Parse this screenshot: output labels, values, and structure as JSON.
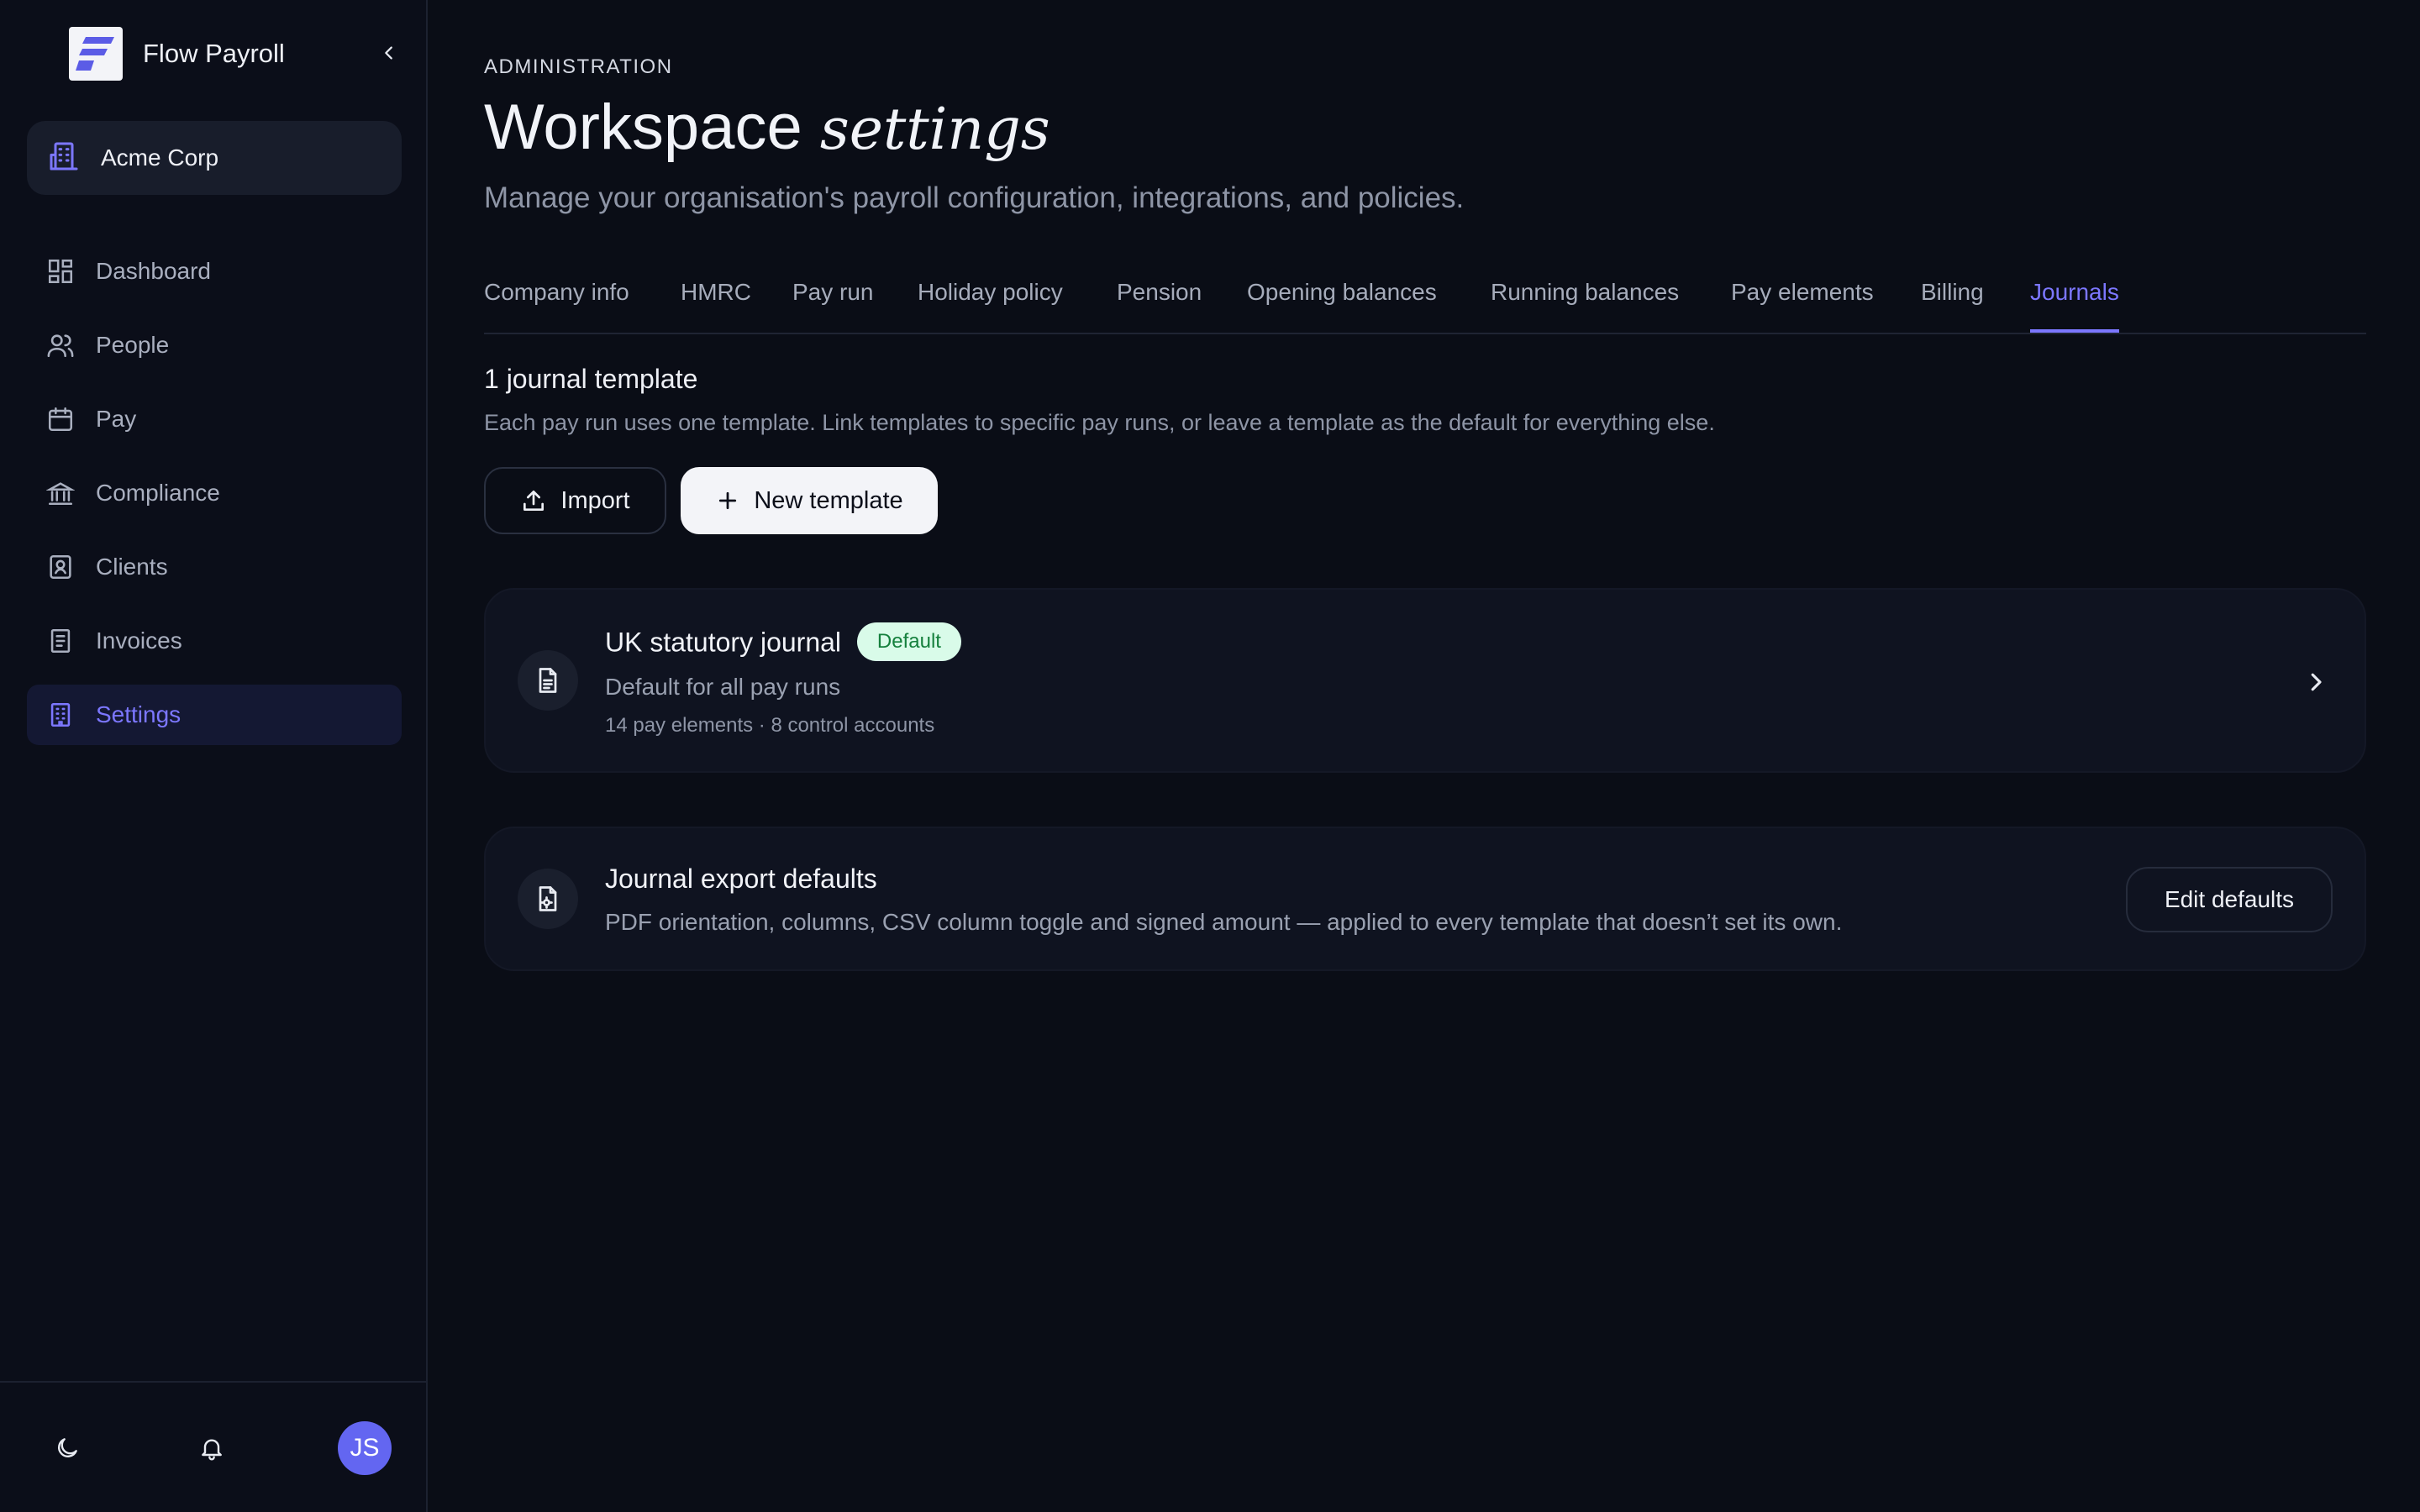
{
  "brand": {
    "name": "Flow Payroll"
  },
  "workspace": {
    "name": "Acme Corp"
  },
  "nav": {
    "items": [
      {
        "label": "Dashboard",
        "icon": "grid-icon"
      },
      {
        "label": "People",
        "icon": "users-icon"
      },
      {
        "label": "Pay",
        "icon": "calendar-icon"
      },
      {
        "label": "Compliance",
        "icon": "bank-icon"
      },
      {
        "label": "Clients",
        "icon": "contact-book-icon"
      },
      {
        "label": "Invoices",
        "icon": "receipt-icon"
      },
      {
        "label": "Settings",
        "icon": "building-icon",
        "active": true
      }
    ]
  },
  "footer": {
    "avatar_initials": "JS"
  },
  "header": {
    "eyebrow": "ADMINISTRATION",
    "title_main": "Workspace",
    "title_serif": "settings",
    "subtitle": "Manage your organisation's payroll configuration, integrations, and policies."
  },
  "tabs": [
    "Company info",
    "HMRC",
    "Pay run",
    "Holiday policy",
    "Pension",
    "Opening balances",
    "Running balances",
    "Pay elements",
    "Billing",
    "Journals"
  ],
  "active_tab": "Journals",
  "journals": {
    "count_title": "1 journal template",
    "description": "Each pay run uses one template. Link templates to specific pay runs, or leave a template as the default for everything else.",
    "import_label": "Import",
    "new_label": "New template"
  },
  "template": {
    "name": "UK statutory journal",
    "badge": "Default",
    "subtitle": "Default for all pay runs",
    "meta": "14 pay elements · 8 control accounts"
  },
  "export_defaults": {
    "title": "Journal export defaults",
    "description": "PDF orientation, columns, CSV column toggle and signed amount — applied to every template that doesn’t set its own.",
    "button": "Edit defaults"
  },
  "colors": {
    "accent": "#7c77ff",
    "background": "#0a0d16",
    "badge_bg": "#d9fbe9",
    "badge_text": "#15803d"
  }
}
